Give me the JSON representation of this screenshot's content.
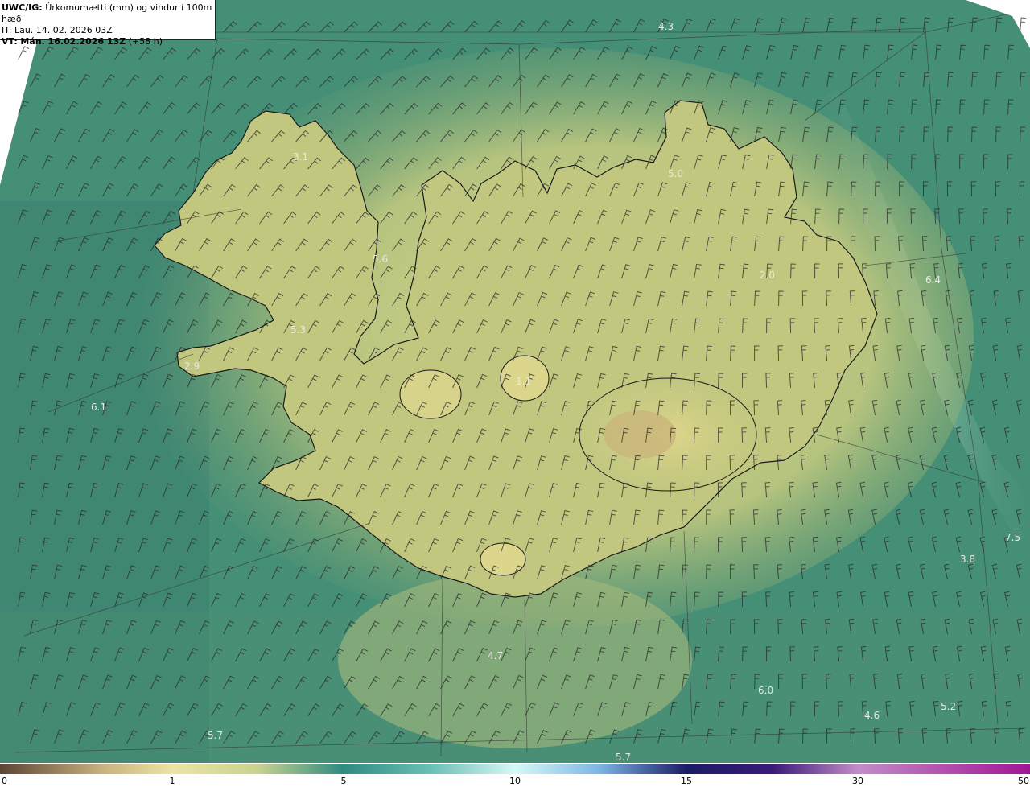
{
  "header": {
    "title_prefix": "UWC/IG:",
    "title": "Úrkomumætti (mm) og vindur í 100m hæð",
    "init_time": "IT: Lau. 14. 02. 2026 03Z",
    "valid_prefix": "VT:",
    "valid_time": "Mán. 16.02.2026 13Z",
    "lead": "(+58 h)"
  },
  "station_values": [
    {
      "label": "4.3"
    },
    {
      "label": "5.0"
    },
    {
      "label": "3.1"
    },
    {
      "label": "5.6"
    },
    {
      "label": "2.0"
    },
    {
      "label": "6.4"
    },
    {
      "label": "5.3"
    },
    {
      "label": "2.9"
    },
    {
      "label": "6.1"
    },
    {
      "label": "1.1"
    },
    {
      "label": "7.5"
    },
    {
      "label": "3.8"
    },
    {
      "label": "4.7"
    },
    {
      "label": "6.0"
    },
    {
      "label": "4.6"
    },
    {
      "label": "5.2"
    },
    {
      "label": "5.7"
    },
    {
      "label": "5.7"
    }
  ],
  "legend": {
    "ticks": [
      "0",
      "1",
      "5",
      "10",
      "15",
      "30",
      "50"
    ],
    "colors": [
      "#5c4535",
      "#e8d9a0",
      "#f0ee9c",
      "#7fb88e",
      "#2f8a82",
      "#bff2f2",
      "#7fb8e6",
      "#2a2a9c",
      "#1b1b66",
      "#5a1a78",
      "#c28cc8",
      "#a11595"
    ]
  },
  "map": {
    "sea_color": "#3f8874",
    "land_color": "#d8d98a",
    "coastline_color": "#1a1a1a"
  }
}
